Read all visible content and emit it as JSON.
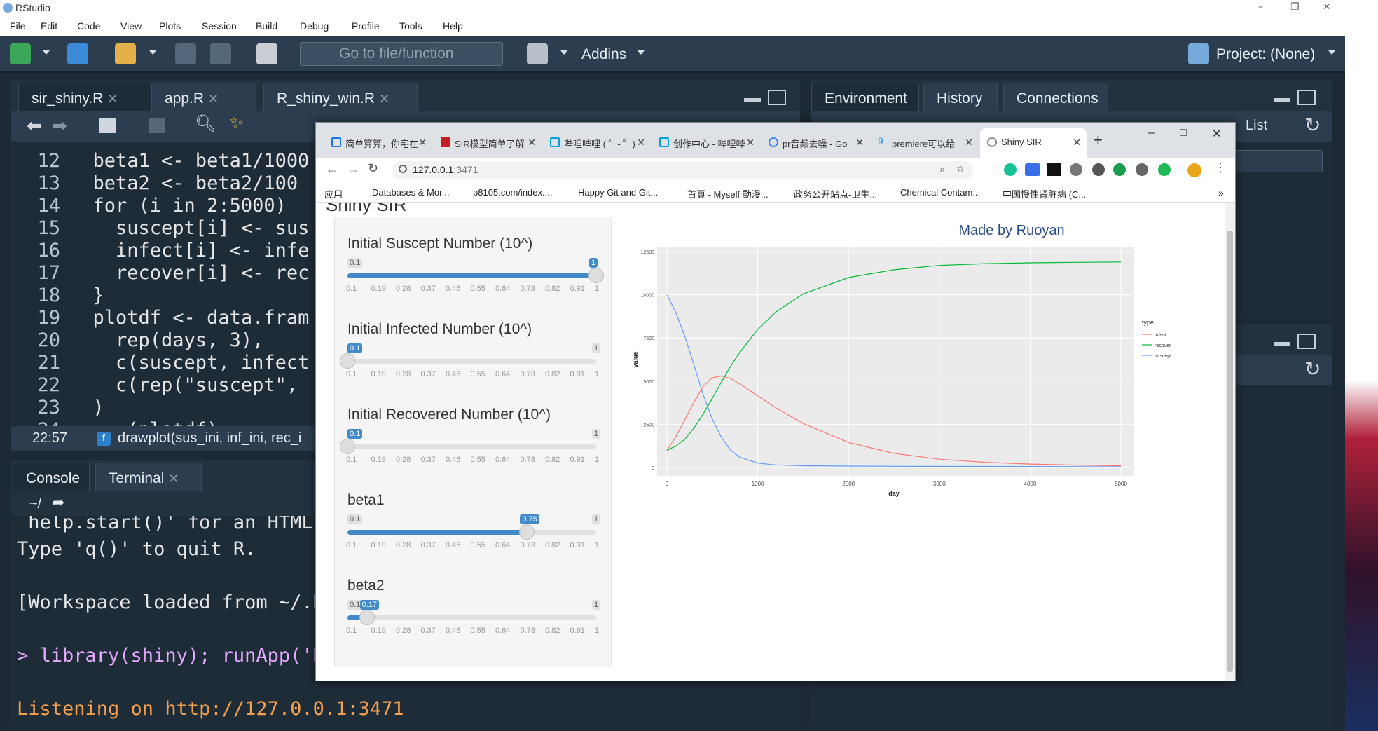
{
  "app": {
    "title": "RStudio"
  },
  "menu": [
    "File",
    "Edit",
    "Code",
    "View",
    "Plots",
    "Session",
    "Build",
    "Debug",
    "Profile",
    "Tools",
    "Help"
  ],
  "toolbar": {
    "goto_placeholder": "Go to file/function",
    "addins": "Addins",
    "project": "Project: (None)"
  },
  "editor": {
    "tabs": [
      "sir_shiny.R",
      "app.R",
      "R_shiny_win.R"
    ],
    "lines": [
      {
        "n": "12",
        "text": "  beta1 <- beta1/1000"
      },
      {
        "n": "13",
        "text": "  beta2 <- beta2/100"
      },
      {
        "n": "14",
        "text": "  for (i in 2:5000) "
      },
      {
        "n": "15",
        "text": "    suscept[i] <- sus"
      },
      {
        "n": "16",
        "text": "    infect[i] <- infe"
      },
      {
        "n": "17",
        "text": "    recover[i] <- rec"
      },
      {
        "n": "18",
        "text": "  }"
      },
      {
        "n": "19",
        "text": "  plotdf <- data.fram"
      },
      {
        "n": "20",
        "text": "    rep(days, 3),"
      },
      {
        "n": "21",
        "text": "    c(suscept, infect"
      },
      {
        "n": "22",
        "text": "    c(rep(\"suscept\","
      },
      {
        "n": "23",
        "text": "  )"
      },
      {
        "n": "24",
        "text": "  ...(plotdf)"
      }
    ],
    "status_pos": "22:57",
    "status_fn": "drawplot(sus_ini, inf_ini, rec_i"
  },
  "console": {
    "tabs": [
      "Console",
      "Terminal"
    ],
    "path": "~/",
    "lines": [
      {
        "text": " help.start()' for an HTML",
        "color": "#e6e6e6"
      },
      {
        "text": "Type 'q()' to quit R.",
        "color": "#e6e6e6"
      },
      {
        "text": "",
        "color": "#e6e6e6"
      },
      {
        "text": "[Workspace loaded from ~/.R",
        "color": "#e6e6e6"
      },
      {
        "text": "",
        "color": "#e6e6e6"
      },
      {
        "text": "> library(shiny); runApp('D",
        "color": "#e3a9ff"
      },
      {
        "text": "",
        "color": "#e6e6e6"
      },
      {
        "text": "Listening on http://127.0.0.1:3471",
        "color": "#f6a04d"
      }
    ]
  },
  "env_pane": {
    "tabs": [
      "Environment",
      "History",
      "Connections"
    ],
    "list_label": "List"
  },
  "browser": {
    "tabs": [
      {
        "label": "简单算算，你宅在",
        "color": "#1a73e8"
      },
      {
        "label": "SIR模型简单了解",
        "color": "#c41e24"
      },
      {
        "label": "哔哩哔哩 ( ゜- ゜)",
        "color": "#00a1d6"
      },
      {
        "label": "创作中心 - 哔哩哔",
        "color": "#00a1d6"
      },
      {
        "label": "pr音频去噪 - Go",
        "color": "#4285f4"
      },
      {
        "label": "premiere可以给",
        "color": "#2a8fd7"
      },
      {
        "label": "Shiny SIR",
        "color": "#888888"
      }
    ],
    "url_host": "127.0.0.1",
    "url_port": ":3471",
    "bookmarks": [
      "应用",
      "Databases & Mor...",
      "p8105.com/index....",
      "Happy Git and Git...",
      "首頁 - Myself 動漫...",
      "政务公开站点-卫生...",
      "Chemical Contam...",
      "中国慢性肾脏病 (C..."
    ]
  },
  "shiny": {
    "page_title": "Shiny SIR",
    "plot_title": "Made by Ruoyan",
    "sliders": [
      {
        "label": "Initial Suscept Number (10^)",
        "min_label": "0.1",
        "max_label": "1",
        "value": 1,
        "value_label": "1",
        "min": 0.1,
        "max": 1
      },
      {
        "label": "Initial Infected Number (10^)",
        "min_label": "0.1",
        "max_label": "1",
        "value": 0.1,
        "value_label": "0.1",
        "min": 0.1,
        "max": 1
      },
      {
        "label": "Initial Recovered Number (10^)",
        "min_label": "0.1",
        "max_label": "1",
        "value": 0.1,
        "value_label": "0.1",
        "min": 0.1,
        "max": 1
      },
      {
        "label": "beta1",
        "min_label": "0.1",
        "max_label": "1",
        "value": 0.75,
        "value_label": "0.75",
        "min": 0.1,
        "max": 1
      },
      {
        "label": "beta2",
        "min_label": "0.1",
        "max_label": "1",
        "value": 0.17,
        "value_label": "0.17",
        "min": 0.1,
        "max": 1
      }
    ],
    "ticks": [
      "0.1",
      "0.19",
      "0.28",
      "0.37",
      "0.46",
      "0.55",
      "0.64",
      "0.73",
      "0.82",
      "0.91",
      "1"
    ]
  },
  "chart_data": {
    "type": "line",
    "title": "Made by Ruoyan",
    "xlabel": "day",
    "ylabel": "value",
    "xlim": [
      0,
      5000
    ],
    "ylim": [
      0,
      12500
    ],
    "xticks": [
      0,
      1000,
      2000,
      3000,
      4000,
      5000
    ],
    "yticks": [
      0,
      2500,
      5000,
      7500,
      10000,
      12500
    ],
    "grid": true,
    "legend_title": "type",
    "legend_position": "right",
    "series": [
      {
        "name": "infect",
        "color": "#f8766d",
        "x": [
          0,
          100,
          200,
          300,
          400,
          500,
          600,
          700,
          800,
          1000,
          1200,
          1500,
          2000,
          2500,
          3000,
          3500,
          4000,
          4500,
          5000
        ],
        "y": [
          1000,
          1800,
          2800,
          3800,
          4700,
          5200,
          5300,
          5150,
          4850,
          4150,
          3450,
          2550,
          1450,
          820,
          480,
          300,
          200,
          140,
          100
        ]
      },
      {
        "name": "recover",
        "color": "#00ba38",
        "x": [
          0,
          100,
          200,
          300,
          400,
          500,
          600,
          700,
          800,
          1000,
          1200,
          1500,
          2000,
          2500,
          3000,
          3500,
          4000,
          4500,
          5000
        ],
        "y": [
          1000,
          1250,
          1650,
          2300,
          3100,
          4000,
          4950,
          5850,
          6650,
          8000,
          9000,
          10050,
          11000,
          11450,
          11700,
          11800,
          11850,
          11880,
          11900
        ]
      },
      {
        "name": "suscept",
        "color": "#619cff",
        "x": [
          0,
          100,
          200,
          300,
          400,
          500,
          600,
          700,
          800,
          1000,
          1200,
          1500,
          2000,
          2500,
          3000,
          3500,
          4000,
          4500,
          5000
        ],
        "y": [
          10000,
          8950,
          7550,
          5900,
          4200,
          2800,
          1750,
          1000,
          600,
          250,
          150,
          100,
          80,
          70,
          65,
          60,
          55,
          50,
          50
        ]
      }
    ]
  }
}
